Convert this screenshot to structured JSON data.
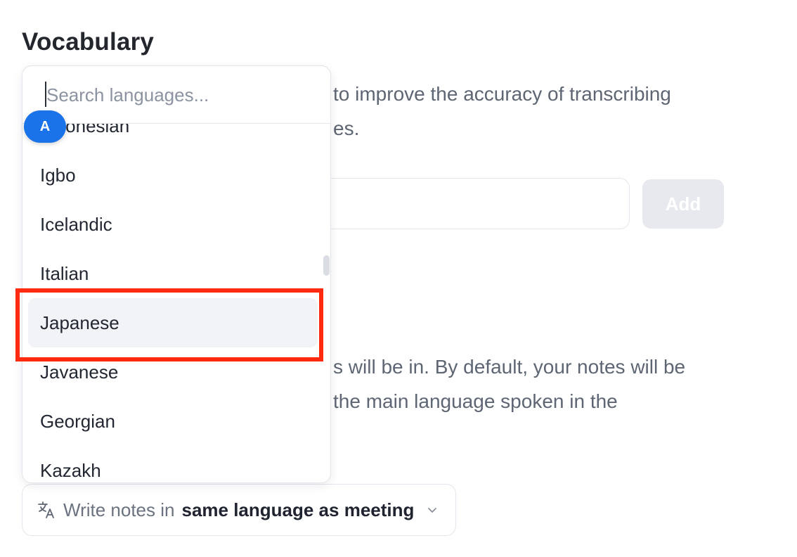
{
  "section": {
    "title": "Vocabulary"
  },
  "vocabulary": {
    "description_line1": "to improve the accuracy of transcribing",
    "description_line2": "es.",
    "input_value": "",
    "add_label": "Add"
  },
  "notes_language": {
    "description_line1": "s will be in. By default, your notes will be",
    "description_line2": "the main language spoken in the",
    "select_prefix": "Write notes in",
    "select_value": "same language as meeting",
    "icon": "translate-icon",
    "chevron": "chevron-down-icon"
  },
  "dropdown": {
    "search_placeholder": "Search languages...",
    "search_value": "",
    "items": [
      {
        "label": "Indonesian",
        "selected": false
      },
      {
        "label": "Igbo",
        "selected": false
      },
      {
        "label": "Icelandic",
        "selected": false
      },
      {
        "label": "Italian",
        "selected": false
      },
      {
        "label": "Japanese",
        "selected": true
      },
      {
        "label": "Javanese",
        "selected": false
      },
      {
        "label": "Georgian",
        "selected": false
      },
      {
        "label": "Kazakh",
        "selected": false
      }
    ]
  },
  "badge": {
    "label": "A",
    "color": "#1a73e8"
  },
  "colors": {
    "highlight": "#ff2a10",
    "selected_row": "#f1f3f7"
  }
}
